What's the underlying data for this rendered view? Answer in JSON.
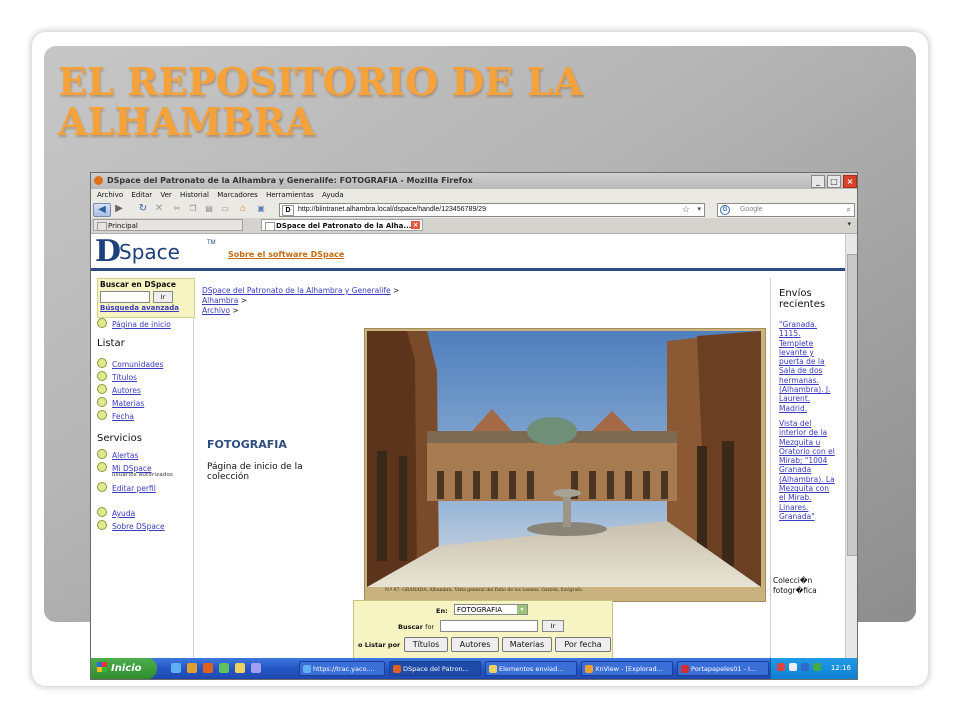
{
  "slide": {
    "title": "EL REPOSITORIO DE LA ALHAMBRA"
  },
  "browser": {
    "window_title": "DSpace del Patronato de la Alhambra y Generalife: FOTOGRAFIA - Mozilla Firefox",
    "menu": [
      "Archivo",
      "Editar",
      "Ver",
      "Historial",
      "Marcadores",
      "Herramientas",
      "Ayuda"
    ],
    "url": "http://blintranet.alhambra.local/dspace/handle/123456789/29",
    "search_placeholder": "Google",
    "tabs": [
      {
        "label": "Principal",
        "active": false
      },
      {
        "label": "DSpace del Patronato de la Alha...",
        "active": true
      }
    ]
  },
  "dspace": {
    "logo_d": "D",
    "logo_rest": "Space",
    "logo_tm": "TM",
    "about_link": "Sobre el software DSpace",
    "search_label": "Buscar en DSpace",
    "search_button": "Ir",
    "advanced_search": "Búsqueda avanzada",
    "home_link": "Página de inicio",
    "browse_heading": "Listar",
    "browse_items": [
      "Comunidades",
      "Títulos",
      "Autores",
      "Materias",
      "Fecha"
    ],
    "services_heading": "Servicios",
    "alerts": "Alertas",
    "my_dspace": "Mi DSpace",
    "my_dspace_sub": "usuarios autorizados",
    "edit_profile": "Editar perfil",
    "help": "Ayuda",
    "about": "Sobre DSpace",
    "breadcrumb": [
      "DSpace del Patronato de la Alhambra y Generalife",
      "Alhambra",
      "Archivo"
    ],
    "crumb_separator": ">",
    "collection_title": "FOTOGRAFIA",
    "collection_subtitle": "Página de inicio de la colección",
    "photo_caption": "N.º 87.     GRANADA.     Alhambra.     Vista general del Patio de los Leones.     Garzón, fotógrafo.",
    "search_form": {
      "in_label": "En:",
      "in_value": "FOTOGRAFIA",
      "search_for_label": "Buscar",
      "search_for_suffix": "for",
      "go_button": "Ir",
      "browse_label": "o Listar por",
      "browse_buttons": [
        "Títulos",
        "Autores",
        "Materias",
        "Por fecha"
      ]
    },
    "recent_heading": "Envíos recientes",
    "recent_items": [
      "\"Granada. 1115. Templete levante y puerta de la Sala de dos hermanas. (Alhambra). J. Laurent. Madrid.",
      "Vista del interior de la Mezquita u Oratorio con el Mirab; \"1004 Granada (Alhambra). La Mezquita con el Mirab. Linares. Granada\""
    ],
    "recent_footer": "Colecci�n fotogr�fica"
  },
  "taskbar": {
    "start": "Inicio",
    "tasks": [
      {
        "label": "https://trac.yaco....",
        "active": false
      },
      {
        "label": "DSpace del Patron...",
        "active": true
      },
      {
        "label": "Elementos enviad...",
        "active": false
      },
      {
        "label": "XnView - [Explorad...",
        "active": false
      },
      {
        "label": "Portapapeles01 - I...",
        "active": false
      }
    ],
    "clock": "12:16"
  }
}
